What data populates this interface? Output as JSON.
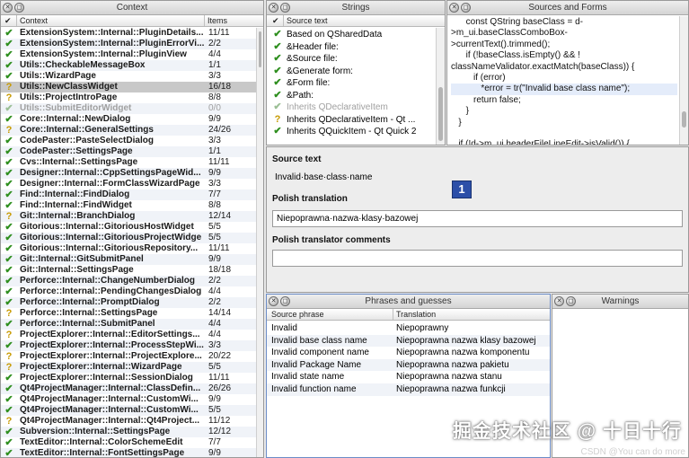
{
  "context_pane": {
    "title": "Context",
    "col_context": "Context",
    "col_items": "Items",
    "rows": [
      {
        "icon": "ok",
        "name": "ExtensionSystem::Internal::PluginDetails...",
        "items": "11/11"
      },
      {
        "icon": "ok",
        "name": "ExtensionSystem::Internal::PluginErrorVi...",
        "items": "2/2"
      },
      {
        "icon": "ok",
        "name": "ExtensionSystem::Internal::PluginView",
        "items": "4/4"
      },
      {
        "icon": "ok",
        "name": "Utils::CheckableMessageBox",
        "items": "1/1"
      },
      {
        "icon": "ok",
        "name": "Utils::WizardPage",
        "items": "3/3"
      },
      {
        "icon": "q",
        "name": "Utils::NewClassWidget",
        "items": "16/18",
        "selected": true
      },
      {
        "icon": "q",
        "name": "Utils::ProjectIntroPage",
        "items": "8/8"
      },
      {
        "icon": "dim",
        "name": "Utils::SubmitEditorWidget",
        "items": "0/0",
        "dim": true
      },
      {
        "icon": "ok",
        "name": "Core::Internal::NewDialog",
        "items": "9/9"
      },
      {
        "icon": "q",
        "name": "Core::Internal::GeneralSettings",
        "items": "24/26"
      },
      {
        "icon": "ok",
        "name": "CodePaster::PasteSelectDialog",
        "items": "3/3"
      },
      {
        "icon": "ok",
        "name": "CodePaster::SettingsPage",
        "items": "1/1"
      },
      {
        "icon": "ok",
        "name": "Cvs::Internal::SettingsPage",
        "items": "11/11"
      },
      {
        "icon": "ok",
        "name": "Designer::Internal::CppSettingsPageWid...",
        "items": "9/9"
      },
      {
        "icon": "ok",
        "name": "Designer::Internal::FormClassWizardPage",
        "items": "3/3"
      },
      {
        "icon": "ok",
        "name": "Find::Internal::FindDialog",
        "items": "7/7"
      },
      {
        "icon": "ok",
        "name": "Find::Internal::FindWidget",
        "items": "8/8"
      },
      {
        "icon": "q",
        "name": "Git::Internal::BranchDialog",
        "items": "12/14"
      },
      {
        "icon": "ok",
        "name": "Gitorious::Internal::GitoriousHostWidget",
        "items": "5/5"
      },
      {
        "icon": "ok",
        "name": "Gitorious::Internal::GitoriousProjectWidge",
        "items": "5/5"
      },
      {
        "icon": "ok",
        "name": "Gitorious::Internal::GitoriousRepository...",
        "items": "11/11"
      },
      {
        "icon": "ok",
        "name": "Git::Internal::GitSubmitPanel",
        "items": "9/9"
      },
      {
        "icon": "ok",
        "name": "Git::Internal::SettingsPage",
        "items": "18/18"
      },
      {
        "icon": "ok",
        "name": "Perforce::Internal::ChangeNumberDialog",
        "items": "2/2"
      },
      {
        "icon": "ok",
        "name": "Perforce::Internal::PendingChangesDialog",
        "items": "4/4"
      },
      {
        "icon": "ok",
        "name": "Perforce::Internal::PromptDialog",
        "items": "2/2"
      },
      {
        "icon": "q",
        "name": "Perforce::Internal::SettingsPage",
        "items": "14/14"
      },
      {
        "icon": "ok",
        "name": "Perforce::Internal::SubmitPanel",
        "items": "4/4"
      },
      {
        "icon": "q",
        "name": "ProjectExplorer::Internal::EditorSettings...",
        "items": "4/4"
      },
      {
        "icon": "ok",
        "name": "ProjectExplorer::Internal::ProcessStepWi...",
        "items": "3/3"
      },
      {
        "icon": "q",
        "name": "ProjectExplorer::Internal::ProjectExplore...",
        "items": "20/22"
      },
      {
        "icon": "q",
        "name": "ProjectExplorer::Internal::WizardPage",
        "items": "5/5"
      },
      {
        "icon": "ok",
        "name": "ProjectExplorer::Internal::SessionDialog",
        "items": "11/11"
      },
      {
        "icon": "ok",
        "name": "Qt4ProjectManager::Internal::ClassDefin...",
        "items": "26/26"
      },
      {
        "icon": "ok",
        "name": "Qt4ProjectManager::Internal::CustomWi...",
        "items": "9/9"
      },
      {
        "icon": "ok",
        "name": "Qt4ProjectManager::Internal::CustomWi...",
        "items": "5/5"
      },
      {
        "icon": "q",
        "name": "Qt4ProjectManager::Internal::Qt4Project...",
        "items": "11/12"
      },
      {
        "icon": "ok",
        "name": "Subversion::Internal::SettingsPage",
        "items": "12/12"
      },
      {
        "icon": "ok",
        "name": "TextEditor::Internal::ColorSchemeEdit",
        "items": "7/7"
      },
      {
        "icon": "ok",
        "name": "TextEditor::Internal::FontSettingsPage",
        "items": "9/9"
      }
    ]
  },
  "strings_pane": {
    "title": "Strings",
    "col_source": "Source text",
    "rows": [
      {
        "icon": "ok",
        "text": "Based on QSharedData"
      },
      {
        "icon": "ok",
        "text": "&Header file:"
      },
      {
        "icon": "ok",
        "text": "&Source file:"
      },
      {
        "icon": "ok",
        "text": "&Generate form:"
      },
      {
        "icon": "ok",
        "text": "&Form file:"
      },
      {
        "icon": "ok",
        "text": "&Path:"
      },
      {
        "icon": "dim",
        "text": "Inherits QDeclarativeItem",
        "dim": true
      },
      {
        "icon": "q",
        "text": "Inherits QDeclarativeItem - Qt ..."
      },
      {
        "icon": "ok",
        "text": "Inherits QQuickItem - Qt Quick 2"
      }
    ]
  },
  "sources_pane": {
    "title": "Sources and Forms",
    "code_lines": [
      "      const QString baseClass = d-",
      ">m_ui.baseClassComboBox-",
      ">currentText().trimmed();",
      "      if (!baseClass.isEmpty() && !",
      "classNameValidator.exactMatch(baseClass)) {",
      "         if (error)",
      "            *error = tr(\"Invalid base class name\");",
      "         return false;",
      "      }",
      "   }",
      "",
      "   if (!d->m_ui.headerFileLineEdit->isValid()) {"
    ],
    "highlight_line": 6
  },
  "editor": {
    "source_label": "Source text",
    "source_value": "Invalid·base·class·name",
    "translation_label": "Polish translation",
    "translation_value": "Niepoprawna·nazwa·klasy·bazowej",
    "comments_label": "Polish translator comments",
    "comments_value": "",
    "badge": "1"
  },
  "phrases_pane": {
    "title": "Phrases and guesses",
    "col_source": "Source phrase",
    "col_translation": "Translation",
    "rows": [
      {
        "source": "Invalid",
        "translation": "Niepoprawny"
      },
      {
        "source": "Invalid base class name",
        "translation": "Niepoprawna nazwa klasy bazowej"
      },
      {
        "source": "Invalid component name",
        "translation": "Niepoprawna nazwa komponentu"
      },
      {
        "source": "Invalid Package Name",
        "translation": "Niepoprawna nazwa pakietu"
      },
      {
        "source": "Invalid state name",
        "translation": "Niepoprawna nazwa stanu"
      },
      {
        "source": "Invalid function name",
        "translation": "Niepoprawna nazwa funkcji"
      }
    ]
  },
  "warnings_pane": {
    "title": "Warnings"
  },
  "watermark": {
    "main": "掘金技术社区 @ 十日十行",
    "small": "CSDN @You can do more"
  },
  "colors": {
    "check_green": "#2f8f1f",
    "question_yellow": "#c79a00",
    "badge_blue": "#2c4fa8"
  }
}
